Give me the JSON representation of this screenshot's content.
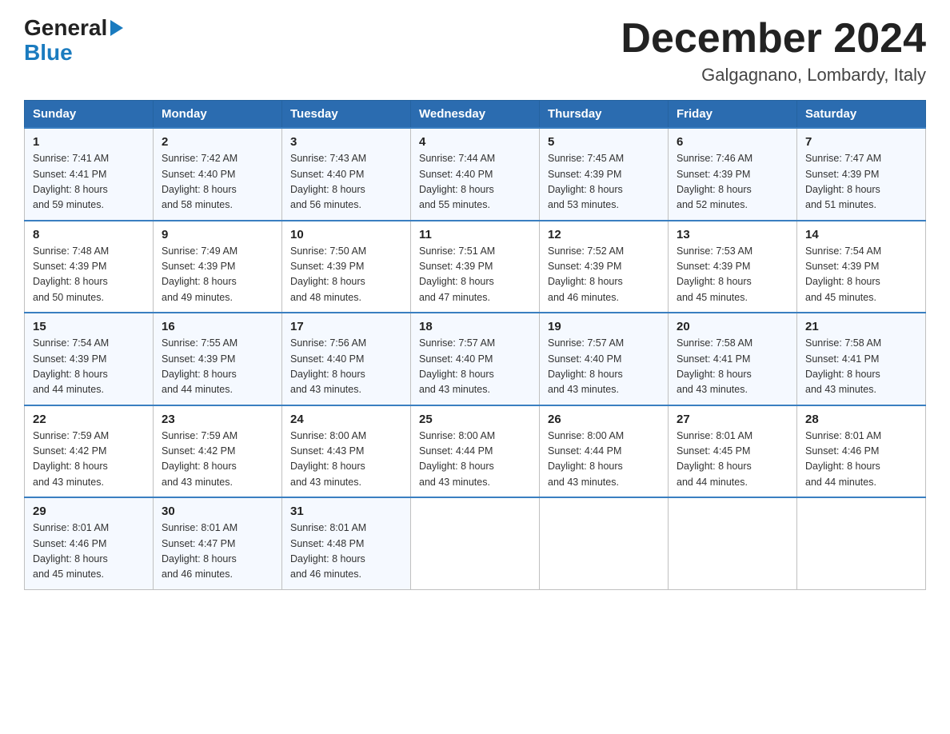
{
  "header": {
    "logo_general": "General",
    "logo_blue": "Blue",
    "title": "December 2024",
    "subtitle": "Galgagnano, Lombardy, Italy"
  },
  "days_of_week": [
    "Sunday",
    "Monday",
    "Tuesday",
    "Wednesday",
    "Thursday",
    "Friday",
    "Saturday"
  ],
  "weeks": [
    [
      {
        "day": "1",
        "sunrise": "7:41 AM",
        "sunset": "4:41 PM",
        "daylight": "8 hours and 59 minutes."
      },
      {
        "day": "2",
        "sunrise": "7:42 AM",
        "sunset": "4:40 PM",
        "daylight": "8 hours and 58 minutes."
      },
      {
        "day": "3",
        "sunrise": "7:43 AM",
        "sunset": "4:40 PM",
        "daylight": "8 hours and 56 minutes."
      },
      {
        "day": "4",
        "sunrise": "7:44 AM",
        "sunset": "4:40 PM",
        "daylight": "8 hours and 55 minutes."
      },
      {
        "day": "5",
        "sunrise": "7:45 AM",
        "sunset": "4:39 PM",
        "daylight": "8 hours and 53 minutes."
      },
      {
        "day": "6",
        "sunrise": "7:46 AM",
        "sunset": "4:39 PM",
        "daylight": "8 hours and 52 minutes."
      },
      {
        "day": "7",
        "sunrise": "7:47 AM",
        "sunset": "4:39 PM",
        "daylight": "8 hours and 51 minutes."
      }
    ],
    [
      {
        "day": "8",
        "sunrise": "7:48 AM",
        "sunset": "4:39 PM",
        "daylight": "8 hours and 50 minutes."
      },
      {
        "day": "9",
        "sunrise": "7:49 AM",
        "sunset": "4:39 PM",
        "daylight": "8 hours and 49 minutes."
      },
      {
        "day": "10",
        "sunrise": "7:50 AM",
        "sunset": "4:39 PM",
        "daylight": "8 hours and 48 minutes."
      },
      {
        "day": "11",
        "sunrise": "7:51 AM",
        "sunset": "4:39 PM",
        "daylight": "8 hours and 47 minutes."
      },
      {
        "day": "12",
        "sunrise": "7:52 AM",
        "sunset": "4:39 PM",
        "daylight": "8 hours and 46 minutes."
      },
      {
        "day": "13",
        "sunrise": "7:53 AM",
        "sunset": "4:39 PM",
        "daylight": "8 hours and 45 minutes."
      },
      {
        "day": "14",
        "sunrise": "7:54 AM",
        "sunset": "4:39 PM",
        "daylight": "8 hours and 45 minutes."
      }
    ],
    [
      {
        "day": "15",
        "sunrise": "7:54 AM",
        "sunset": "4:39 PM",
        "daylight": "8 hours and 44 minutes."
      },
      {
        "day": "16",
        "sunrise": "7:55 AM",
        "sunset": "4:39 PM",
        "daylight": "8 hours and 44 minutes."
      },
      {
        "day": "17",
        "sunrise": "7:56 AM",
        "sunset": "4:40 PM",
        "daylight": "8 hours and 43 minutes."
      },
      {
        "day": "18",
        "sunrise": "7:57 AM",
        "sunset": "4:40 PM",
        "daylight": "8 hours and 43 minutes."
      },
      {
        "day": "19",
        "sunrise": "7:57 AM",
        "sunset": "4:40 PM",
        "daylight": "8 hours and 43 minutes."
      },
      {
        "day": "20",
        "sunrise": "7:58 AM",
        "sunset": "4:41 PM",
        "daylight": "8 hours and 43 minutes."
      },
      {
        "day": "21",
        "sunrise": "7:58 AM",
        "sunset": "4:41 PM",
        "daylight": "8 hours and 43 minutes."
      }
    ],
    [
      {
        "day": "22",
        "sunrise": "7:59 AM",
        "sunset": "4:42 PM",
        "daylight": "8 hours and 43 minutes."
      },
      {
        "day": "23",
        "sunrise": "7:59 AM",
        "sunset": "4:42 PM",
        "daylight": "8 hours and 43 minutes."
      },
      {
        "day": "24",
        "sunrise": "8:00 AM",
        "sunset": "4:43 PM",
        "daylight": "8 hours and 43 minutes."
      },
      {
        "day": "25",
        "sunrise": "8:00 AM",
        "sunset": "4:44 PM",
        "daylight": "8 hours and 43 minutes."
      },
      {
        "day": "26",
        "sunrise": "8:00 AM",
        "sunset": "4:44 PM",
        "daylight": "8 hours and 43 minutes."
      },
      {
        "day": "27",
        "sunrise": "8:01 AM",
        "sunset": "4:45 PM",
        "daylight": "8 hours and 44 minutes."
      },
      {
        "day": "28",
        "sunrise": "8:01 AM",
        "sunset": "4:46 PM",
        "daylight": "8 hours and 44 minutes."
      }
    ],
    [
      {
        "day": "29",
        "sunrise": "8:01 AM",
        "sunset": "4:46 PM",
        "daylight": "8 hours and 45 minutes."
      },
      {
        "day": "30",
        "sunrise": "8:01 AM",
        "sunset": "4:47 PM",
        "daylight": "8 hours and 46 minutes."
      },
      {
        "day": "31",
        "sunrise": "8:01 AM",
        "sunset": "4:48 PM",
        "daylight": "8 hours and 46 minutes."
      },
      null,
      null,
      null,
      null
    ]
  ],
  "labels": {
    "sunrise": "Sunrise:",
    "sunset": "Sunset:",
    "daylight": "Daylight:"
  }
}
